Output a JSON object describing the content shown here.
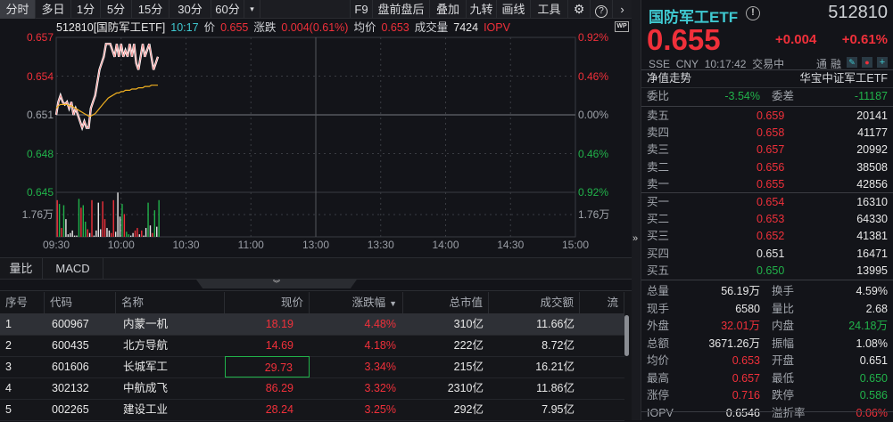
{
  "toolbar": {
    "tabs": [
      "分时",
      "多日",
      "1分",
      "5分",
      "15分",
      "30分",
      "60分"
    ],
    "more": "▾",
    "right": [
      "F9",
      "盘前盘后",
      "叠加",
      "九转",
      "画线",
      "工具"
    ],
    "settings_icon": "gear-icon",
    "help_icon": "help-icon",
    "next_icon": "chevron-right-icon"
  },
  "info": {
    "code_name": "512810[国防军工ETF]",
    "time": "10:17",
    "price_label": "价",
    "price": "0.655",
    "change_label": "涨跌",
    "change": "0.004(0.61%)",
    "avg_label": "均价",
    "avg": "0.653",
    "vol_label": "成交量",
    "vol": "7424",
    "iopv": "IOPV",
    "wp": "WP"
  },
  "chart_data": {
    "type": "line",
    "title": "分时",
    "y_ticks_left": [
      "0.657",
      "0.654",
      "0.651",
      "0.648",
      "0.645"
    ],
    "y_ticks_right": [
      "0.92%",
      "0.46%",
      "0.00%",
      "0.46%",
      "0.92%"
    ],
    "vol_tick": "1.76万",
    "x_ticks": [
      "09:30",
      "10:00",
      "10:30",
      "11:00",
      "13:00",
      "13:30",
      "14:00",
      "14:30",
      "15:00"
    ],
    "ylim": [
      0.645,
      0.657
    ],
    "prev_close": 0.651,
    "price": [
      0.651,
      0.652,
      0.6525,
      0.652,
      0.6518,
      0.652,
      0.6515,
      0.652,
      0.651,
      0.6515,
      0.651,
      0.6505,
      0.65,
      0.6505,
      0.65,
      0.65,
      0.6515,
      0.652,
      0.6525,
      0.6535,
      0.6545,
      0.655,
      0.6555,
      0.6565,
      0.6565,
      0.6565,
      0.656,
      0.6555,
      0.6565,
      0.6555,
      0.6565,
      0.6555,
      0.656,
      0.6555,
      0.6565,
      0.6555,
      0.6565,
      0.655,
      0.6545,
      0.6555,
      0.6565,
      0.6555,
      0.656,
      0.6565,
      0.6555,
      0.6545,
      0.655,
      0.6555
    ],
    "avg": [
      0.6515,
      0.6517,
      0.6518,
      0.6518,
      0.6518,
      0.6518,
      0.6517,
      0.6517,
      0.6516,
      0.6515,
      0.6514,
      0.6513,
      0.6512,
      0.6511,
      0.651,
      0.6509,
      0.6509,
      0.651,
      0.6511,
      0.6513,
      0.6515,
      0.6517,
      0.6519,
      0.6521,
      0.6523,
      0.6524,
      0.6525,
      0.6526,
      0.6527,
      0.6527,
      0.6528,
      0.6528,
      0.6529,
      0.6529,
      0.6529,
      0.653,
      0.653,
      0.653,
      0.6531,
      0.6531,
      0.6531,
      0.6532,
      0.6532,
      0.6532,
      0.6533,
      0.6533,
      0.6533,
      0.6533
    ],
    "volume": [
      2.9,
      2.6,
      0.7,
      2.5,
      1.4,
      0.2,
      0.3,
      0.5,
      0.1,
      0.1,
      3.0,
      2.3,
      2.5,
      1.2,
      0.6,
      0.3,
      2.9,
      0.1,
      0.5,
      2.7,
      0.6,
      2.8,
      1.4,
      0.7,
      0.5,
      0.3,
      2.9,
      0.4,
      3.5,
      1.6,
      2.6,
      1.8,
      0.4,
      0.2,
      0.1,
      0.3,
      0.5,
      0.7,
      0.2,
      0.5,
      0.1,
      0.7,
      2.7,
      0.9,
      0.3,
      2.1,
      0.8,
      2.9
    ],
    "volume_colors": [
      "r",
      "g",
      "r",
      "g",
      "w",
      "w",
      "w",
      "w",
      "w",
      "w",
      "g",
      "r",
      "g",
      "g",
      "r",
      "w",
      "r",
      "w",
      "w",
      "w",
      "w",
      "r",
      "r",
      "w",
      "w",
      "r",
      "r",
      "w",
      "w",
      "w",
      "g",
      "r",
      "g",
      "g",
      "w",
      "w",
      "r",
      "r",
      "w",
      "r",
      "w",
      "w",
      "g",
      "w",
      "r",
      "g",
      "w",
      "g"
    ]
  },
  "sub_tabs": [
    "量比",
    "MACD"
  ],
  "table": {
    "headers": [
      "序号",
      "代码",
      "名称",
      "现价",
      "涨跌幅",
      "总市值",
      "成交额",
      "流"
    ],
    "sort_icon": "▼",
    "rows": [
      [
        "1",
        "600967",
        "内蒙一机",
        "18.19",
        "4.48%",
        "310亿",
        "11.66亿"
      ],
      [
        "2",
        "600435",
        "北方导航",
        "14.69",
        "4.18%",
        "222亿",
        "8.72亿"
      ],
      [
        "3",
        "601606",
        "长城军工",
        "29.73",
        "3.34%",
        "215亿",
        "16.21亿"
      ],
      [
        "4",
        "302132",
        "中航成飞",
        "86.29",
        "3.32%",
        "2310亿",
        "11.86亿"
      ],
      [
        "5",
        "002265",
        "建设工业",
        "28.24",
        "3.25%",
        "292亿",
        "7.95亿"
      ]
    ]
  },
  "quote": {
    "name": "国防军工ETF",
    "code": "512810",
    "price": "0.655",
    "change": "+0.004",
    "pct": "+0.61%",
    "exchange": "SSE",
    "currency": "CNY",
    "time": "10:17:42",
    "status": "交易中",
    "tong": "通",
    "rong": "融",
    "nav_label": "净值走势",
    "fund_name": "华宝中证军工ETF",
    "wb_label": "委比",
    "wb": "-3.54%",
    "wc_label": "委差",
    "wc": "-11187",
    "asks": [
      [
        "卖五",
        "0.659",
        "20141"
      ],
      [
        "卖四",
        "0.658",
        "41177"
      ],
      [
        "卖三",
        "0.657",
        "20992"
      ],
      [
        "卖二",
        "0.656",
        "38508"
      ],
      [
        "卖一",
        "0.655",
        "42856"
      ]
    ],
    "bids": [
      [
        "买一",
        "0.654",
        "16310"
      ],
      [
        "买二",
        "0.653",
        "64330"
      ],
      [
        "买三",
        "0.652",
        "41381"
      ],
      [
        "买四",
        "0.651",
        "16471"
      ],
      [
        "买五",
        "0.650",
        "13995"
      ]
    ],
    "stats": [
      [
        "总量",
        "56.19万",
        "换手",
        "4.59%"
      ],
      [
        "现手",
        "6580",
        "量比",
        "2.68"
      ],
      [
        "外盘",
        "32.01万",
        "内盘",
        "24.18万"
      ],
      [
        "总额",
        "3671.26万",
        "振幅",
        "1.08%"
      ],
      [
        "均价",
        "0.653",
        "开盘",
        "0.651"
      ],
      [
        "最高",
        "0.657",
        "最低",
        "0.650"
      ],
      [
        "涨停",
        "0.716",
        "跌停",
        "0.586"
      ],
      [
        "IOPV",
        "0.6546",
        "溢折率",
        "0.06%"
      ]
    ],
    "stat_colors": [
      [
        "w",
        "w"
      ],
      [
        "w",
        "w"
      ],
      [
        "r",
        "g"
      ],
      [
        "w",
        "w"
      ],
      [
        "r",
        "w"
      ],
      [
        "r",
        "g"
      ],
      [
        "r",
        "g"
      ],
      [
        "w",
        "r"
      ]
    ]
  },
  "colors": {
    "red": "#f0303a",
    "green": "#21b24a",
    "white": "#e8e8e8",
    "avg_line": "#f0b020",
    "accent": "#3fc8d0"
  }
}
